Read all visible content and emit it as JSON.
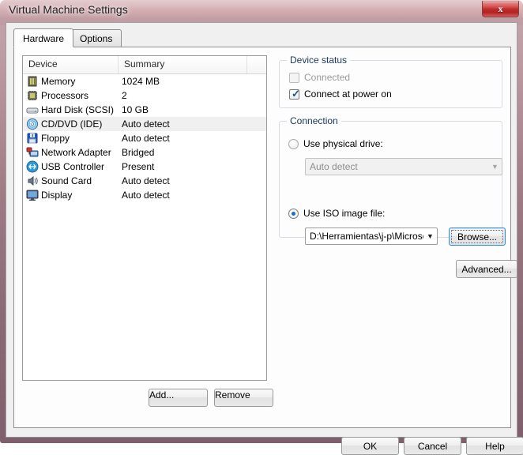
{
  "window": {
    "title": "Virtual Machine Settings",
    "close_label": "x",
    "frame_color": "#9d7a84",
    "close_color": "#c02a2a"
  },
  "tabs": [
    {
      "label": "Hardware",
      "active": true
    },
    {
      "label": "Options",
      "active": false
    }
  ],
  "device_list": {
    "columns": [
      "Device",
      "Summary",
      ""
    ],
    "rows": [
      {
        "icon": "memory-icon",
        "name": "Memory",
        "summary": "1024 MB",
        "selected": false
      },
      {
        "icon": "processors-icon",
        "name": "Processors",
        "summary": "2",
        "selected": false
      },
      {
        "icon": "hard-disk-icon",
        "name": "Hard Disk (SCSI)",
        "summary": "10 GB",
        "selected": false
      },
      {
        "icon": "cd-dvd-icon",
        "name": "CD/DVD (IDE)",
        "summary": "Auto detect",
        "selected": true
      },
      {
        "icon": "floppy-icon",
        "name": "Floppy",
        "summary": "Auto detect",
        "selected": false
      },
      {
        "icon": "network-adapter-icon",
        "name": "Network Adapter",
        "summary": "Bridged",
        "selected": false
      },
      {
        "icon": "usb-controller-icon",
        "name": "USB Controller",
        "summary": "Present",
        "selected": false
      },
      {
        "icon": "sound-card-icon",
        "name": "Sound Card",
        "summary": "Auto detect",
        "selected": false
      },
      {
        "icon": "display-icon",
        "name": "Display",
        "summary": "Auto detect",
        "selected": false
      }
    ],
    "add_label": "Add...",
    "remove_label": "Remove"
  },
  "device_status": {
    "title": "Device status",
    "connected": {
      "label": "Connected",
      "checked": false,
      "disabled": true
    },
    "connect_at_power_on": {
      "label": "Connect at power on",
      "checked": true,
      "disabled": false
    }
  },
  "connection": {
    "title": "Connection",
    "use_physical_drive": {
      "label": "Use physical drive:",
      "selected": false
    },
    "physical_drive_value": "Auto detect",
    "physical_drive_disabled": true,
    "use_iso_image": {
      "label": "Use ISO image file:",
      "selected": true
    },
    "iso_path_value": "D:\\Herramientas\\j-p\\Microsoft'",
    "browse_label": "Browse..."
  },
  "advanced_label": "Advanced...",
  "dialog_buttons": {
    "ok": "OK",
    "cancel": "Cancel",
    "help": "Help"
  }
}
